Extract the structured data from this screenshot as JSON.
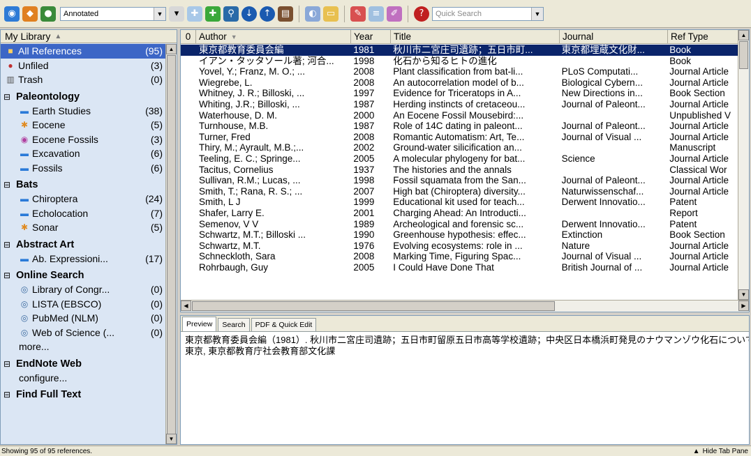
{
  "toolbar": {
    "style_value": "Annotated",
    "search_placeholder": "Quick Search",
    "icons": [
      "globe-connect-icon",
      "integrated-library-icon",
      "online-library-icon",
      "new-reference-icon",
      "find-full-text-icon",
      "find-references-icon",
      "import-icon",
      "export-icon",
      "open-link-icon",
      "web-icon",
      "folder-icon",
      "insert-citation-icon",
      "format-bibliography-icon",
      "edit-citation-icon",
      "help-icon"
    ]
  },
  "sidebar": {
    "header": "My Library",
    "top_items": [
      {
        "label": "All References",
        "count": "(95)",
        "icon": "all-references-icon",
        "selected": true
      },
      {
        "label": "Unfiled",
        "count": "(3)",
        "icon": "unfiled-icon"
      },
      {
        "label": "Trash",
        "count": "(0)",
        "icon": "trash-icon"
      }
    ],
    "groups": [
      {
        "title": "Paleontology",
        "items": [
          {
            "label": "Earth Studies",
            "count": "(38)",
            "icon": "folder-icon"
          },
          {
            "label": "Eocene",
            "count": "(5)",
            "icon": "smart-group-icon"
          },
          {
            "label": "Eocene Fossils",
            "count": "(3)",
            "icon": "combined-group-icon"
          },
          {
            "label": "Excavation",
            "count": "(6)",
            "icon": "folder-icon"
          },
          {
            "label": "Fossils",
            "count": "(6)",
            "icon": "folder-icon"
          }
        ]
      },
      {
        "title": "Bats",
        "items": [
          {
            "label": "Chiroptera",
            "count": "(24)",
            "icon": "folder-icon"
          },
          {
            "label": "Echolocation",
            "count": "(7)",
            "icon": "folder-icon"
          },
          {
            "label": "Sonar",
            "count": "(5)",
            "icon": "smart-group-icon"
          }
        ]
      },
      {
        "title": "Abstract Art",
        "items": [
          {
            "label": "Ab. Expressioni...",
            "count": "(17)",
            "icon": "folder-icon"
          }
        ]
      },
      {
        "title": "Online Search",
        "items": [
          {
            "label": "Library of Congr...",
            "count": "(0)",
            "icon": "online-search-icon"
          },
          {
            "label": "LISTA (EBSCO)",
            "count": "(0)",
            "icon": "online-search-icon"
          },
          {
            "label": "PubMed (NLM)",
            "count": "(0)",
            "icon": "online-search-icon"
          },
          {
            "label": "Web of Science (...",
            "count": "(0)",
            "icon": "online-search-icon"
          },
          {
            "label": "more...",
            "count": "",
            "icon": ""
          }
        ]
      },
      {
        "title": "EndNote Web",
        "items": [
          {
            "label": "configure...",
            "count": "",
            "icon": ""
          }
        ]
      },
      {
        "title": "Find Full Text",
        "items": []
      }
    ]
  },
  "references": {
    "columns": [
      "Author",
      "Year",
      "Title",
      "Journal",
      "Ref Type"
    ],
    "rows": [
      [
        "東京都教育委員会編",
        "1981",
        "秋川市二宮庄司遺跡；五日市町...",
        "東京都埋蔵文化財...",
        "Book"
      ],
      [
        "イアン・タッタソール著; 河合...",
        "1998",
        "化石から知るヒトの進化",
        "",
        "Book"
      ],
      [
        "Yovel, Y.; Franz, M. O.; ...",
        "2008",
        "Plant classification from bat-li...",
        "PLoS Computati...",
        "Journal Article"
      ],
      [
        "Wiegrebe, L.",
        "2008",
        "An autocorrelation model of b...",
        "Biological Cybern...",
        "Journal Article"
      ],
      [
        "Whitney, J. R.; Billoski, ...",
        "1997",
        "Evidence for Triceratops in A...",
        "New Directions in...",
        "Book Section"
      ],
      [
        "Whiting, J.R.; Billoski, ...",
        "1987",
        "Herding instincts of cretaceou...",
        "Journal of Paleont...",
        "Journal Article"
      ],
      [
        "Waterhouse, D. M.",
        "2000",
        "An Eocene Fossil Mousebird:...",
        "",
        "Unpublished V"
      ],
      [
        "Turnhouse, M.B.",
        "1987",
        "Role of 14C dating in paleont...",
        "Journal of Paleont...",
        "Journal Article"
      ],
      [
        "Turner, Fred",
        "2008",
        "Romantic Automatism: Art, Te...",
        "Journal of Visual ...",
        "Journal Article"
      ],
      [
        "Thiry, M.; Ayrault, M.B.;...",
        "2002",
        "Ground-water silicification an...",
        "",
        "Manuscript"
      ],
      [
        "Teeling, E. C.; Springe...",
        "2005",
        "A molecular phylogeny for bat...",
        "Science",
        "Journal Article"
      ],
      [
        "Tacitus, Cornelius",
        "1937",
        "The histories and the annals",
        "",
        "Classical Wor"
      ],
      [
        "Sullivan, R.M.; Lucas, ...",
        "1998",
        "Fossil squamata from the San...",
        "Journal of Paleont...",
        "Journal Article"
      ],
      [
        "Smith, T.; Rana, R. S.; ...",
        "2007",
        "High bat (Chiroptera) diversity...",
        "Naturwissenschaf...",
        "Journal Article"
      ],
      [
        "Smith, L J",
        "1999",
        "Educational kit used for teach...",
        "Derwent Innovatio...",
        "Patent"
      ],
      [
        "Shafer, Larry E.",
        "2001",
        "Charging Ahead: An Introducti...",
        "",
        "Report"
      ],
      [
        "Semenov, V V",
        "1989",
        "Archeological and forensic sc...",
        "Derwent Innovatio...",
        "Patent"
      ],
      [
        "Schwartz, M.T.; Billoski ...",
        "1990",
        "Greenhouse hypothesis: effec...",
        "Extinction",
        "Book Section"
      ],
      [
        "Schwartz, M.T.",
        "1976",
        "Evolving ecosystems: role in ...",
        "Nature",
        "Journal Article"
      ],
      [
        "Schneckloth, Sara",
        "2008",
        "Marking Time, Figuring Spac...",
        "Journal of Visual ...",
        "Journal Article"
      ],
      [
        "Rohrbaugh, Guy",
        "2005",
        "I Could Have Done That",
        "British Journal of ...",
        "Journal Article"
      ]
    ]
  },
  "preview": {
    "tabs": [
      "Preview",
      "Search",
      "PDF & Quick Edit"
    ],
    "line1": "東京都教育委員会編（1981）. 秋川市二宮庄司遺跡；五日市町留原五日市高等学校遺跡；中央区日本橋浜町発見のナウマンゾウ化石について.",
    "line2": "東京, 東京都教育庁社会教育部文化課"
  },
  "status": {
    "text": "Showing 95 of 95 references.",
    "hide_tab": "Hide Tab Pane"
  }
}
